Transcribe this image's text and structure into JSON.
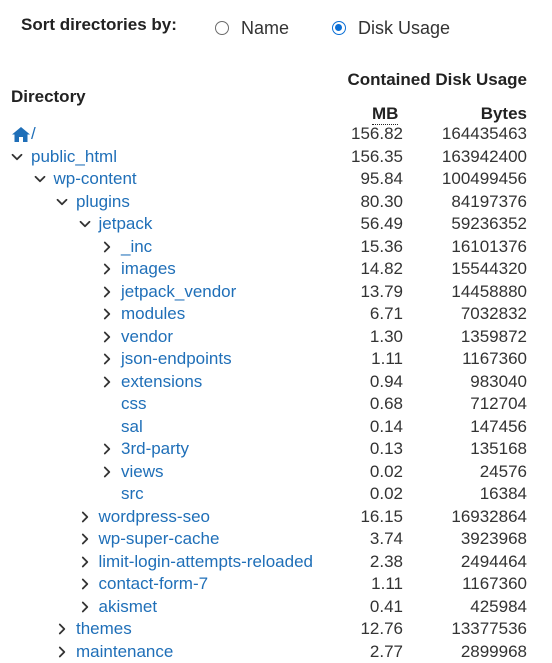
{
  "sort": {
    "label": "Sort directories by:",
    "options": [
      {
        "label": "Name",
        "checked": false
      },
      {
        "label": "Disk Usage",
        "checked": true
      }
    ]
  },
  "table": {
    "col_directory": "Directory",
    "col_group": "Contained Disk Usage",
    "col_mb": "MB",
    "col_bytes": "Bytes",
    "rows": [
      {
        "name": "/",
        "mb": "156.82",
        "bytes": "164435463",
        "icon": "home-icon",
        "depth": 0,
        "toggle": "none"
      },
      {
        "name": "public_html",
        "mb": "156.35",
        "bytes": "163942400",
        "depth": 0,
        "toggle": "expanded"
      },
      {
        "name": "wp-content",
        "mb": "95.84",
        "bytes": "100499456",
        "depth": 1,
        "toggle": "expanded"
      },
      {
        "name": "plugins",
        "mb": "80.30",
        "bytes": "84197376",
        "depth": 2,
        "toggle": "expanded"
      },
      {
        "name": "jetpack",
        "mb": "56.49",
        "bytes": "59236352",
        "depth": 3,
        "toggle": "expanded"
      },
      {
        "name": "_inc",
        "mb": "15.36",
        "bytes": "16101376",
        "depth": 4,
        "toggle": "collapsed"
      },
      {
        "name": "images",
        "mb": "14.82",
        "bytes": "15544320",
        "depth": 4,
        "toggle": "collapsed"
      },
      {
        "name": "jetpack_vendor",
        "mb": "13.79",
        "bytes": "14458880",
        "depth": 4,
        "toggle": "collapsed"
      },
      {
        "name": "modules",
        "mb": "6.71",
        "bytes": "7032832",
        "depth": 4,
        "toggle": "collapsed"
      },
      {
        "name": "vendor",
        "mb": "1.30",
        "bytes": "1359872",
        "depth": 4,
        "toggle": "collapsed"
      },
      {
        "name": "json-endpoints",
        "mb": "1.11",
        "bytes": "1167360",
        "depth": 4,
        "toggle": "collapsed"
      },
      {
        "name": "extensions",
        "mb": "0.94",
        "bytes": "983040",
        "depth": 4,
        "toggle": "collapsed"
      },
      {
        "name": "css",
        "mb": "0.68",
        "bytes": "712704",
        "depth": 4,
        "toggle": "none"
      },
      {
        "name": "sal",
        "mb": "0.14",
        "bytes": "147456",
        "depth": 4,
        "toggle": "none"
      },
      {
        "name": "3rd-party",
        "mb": "0.13",
        "bytes": "135168",
        "depth": 4,
        "toggle": "collapsed"
      },
      {
        "name": "views",
        "mb": "0.02",
        "bytes": "24576",
        "depth": 4,
        "toggle": "collapsed"
      },
      {
        "name": "src",
        "mb": "0.02",
        "bytes": "16384",
        "depth": 4,
        "toggle": "none"
      },
      {
        "name": "wordpress-seo",
        "mb": "16.15",
        "bytes": "16932864",
        "depth": 3,
        "toggle": "collapsed"
      },
      {
        "name": "wp-super-cache",
        "mb": "3.74",
        "bytes": "3923968",
        "depth": 3,
        "toggle": "collapsed"
      },
      {
        "name": "limit-login-attempts-reloaded",
        "mb": "2.38",
        "bytes": "2494464",
        "depth": 3,
        "toggle": "collapsed"
      },
      {
        "name": "contact-form-7",
        "mb": "1.11",
        "bytes": "1167360",
        "depth": 3,
        "toggle": "collapsed"
      },
      {
        "name": "akismet",
        "mb": "0.41",
        "bytes": "425984",
        "depth": 3,
        "toggle": "collapsed"
      },
      {
        "name": "themes",
        "mb": "12.76",
        "bytes": "13377536",
        "depth": 2,
        "toggle": "collapsed"
      },
      {
        "name": "maintenance",
        "mb": "2.77",
        "bytes": "2899968",
        "depth": 2,
        "toggle": "collapsed"
      }
    ]
  },
  "colors": {
    "link": "#1f6fb8",
    "text": "#333333",
    "radio_accent": "#0a6fd6"
  }
}
